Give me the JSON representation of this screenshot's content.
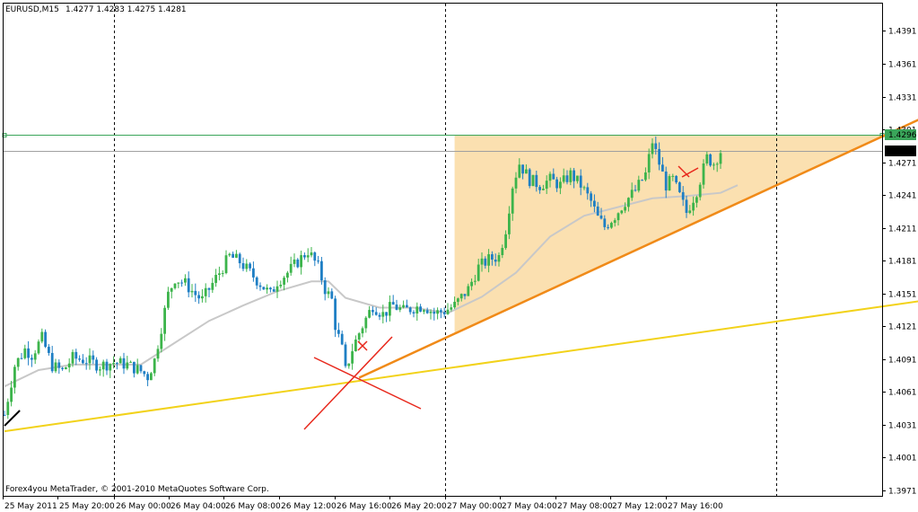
{
  "header": {
    "symbol_tf": "EURUSD,M15",
    "ohlc": "1.4277 1.4283 1.4275 1.4281"
  },
  "footer": {
    "copyright": "Forex4you MetaTrader, © 2001-2010 MetaQuotes Software Corp."
  },
  "colors": {
    "background": "#ffffff",
    "frame": "#000000",
    "bull_candle": "#3cb44b",
    "bear_candle": "#1f7fc4",
    "moving_average": "#c8c8c8",
    "zone_fill": "#fbe0b0",
    "resistance_line": "#3aa55a",
    "price_line": "#a0a0a0",
    "rising_trendline": "#f08a18",
    "support_trendline": "#f2d21a",
    "cross_marks": "#e8281c"
  },
  "chart_data": {
    "type": "candlestick",
    "symbol": "EURUSD",
    "timeframe": "M15",
    "ylim": [
      1.3966,
      1.4416
    ],
    "y_ticks": [
      "1.4391",
      "1.4361",
      "1.4331",
      "1.4301",
      "1.4271",
      "1.4241",
      "1.4211",
      "1.4181",
      "1.4151",
      "1.4121",
      "1.4091",
      "1.4061",
      "1.4031",
      "1.4001",
      "1.3971"
    ],
    "x_ticks": [
      "25 May 2011",
      "25 May 20:00",
      "26 May 00:00",
      "26 May 04:00",
      "26 May 08:00",
      "26 May 12:00",
      "26 May 16:00",
      "26 May 20:00",
      "27 May 00:00",
      "27 May 04:00",
      "27 May 08:00",
      "27 May 12:00",
      "27 May 16:00"
    ],
    "period_separators": [
      "25 May 20:00",
      "26 May 00:00",
      "26 May 20:00",
      "27 May 00:00",
      "27 May 16:00"
    ],
    "price_labels": {
      "resistance": "1.4296",
      "current": "1.4281"
    },
    "horizontal_lines": [
      {
        "role": "resistance",
        "price": 1.4296
      },
      {
        "role": "current-price",
        "price": 1.4281
      }
    ],
    "close_path": [
      [
        0,
        1.404
      ],
      [
        3,
        1.4085
      ],
      [
        6,
        1.41
      ],
      [
        8,
        1.4095
      ],
      [
        11,
        1.411
      ],
      [
        14,
        1.4085
      ],
      [
        17,
        1.408
      ],
      [
        20,
        1.4092
      ],
      [
        24,
        1.409
      ],
      [
        28,
        1.4085
      ],
      [
        32,
        1.4088
      ],
      [
        36,
        1.4086
      ],
      [
        40,
        1.408
      ],
      [
        42,
        1.4075
      ],
      [
        44,
        1.409
      ],
      [
        46,
        1.412
      ],
      [
        48,
        1.415
      ],
      [
        50,
        1.4165
      ],
      [
        53,
        1.416
      ],
      [
        56,
        1.415
      ],
      [
        58,
        1.4145
      ],
      [
        60,
        1.4155
      ],
      [
        63,
        1.417
      ],
      [
        66,
        1.4185
      ],
      [
        69,
        1.418
      ],
      [
        72,
        1.417
      ],
      [
        75,
        1.416
      ],
      [
        78,
        1.415
      ],
      [
        80,
        1.4162
      ],
      [
        83,
        1.417
      ],
      [
        86,
        1.418
      ],
      [
        89,
        1.419
      ],
      [
        92,
        1.4175
      ],
      [
        94,
        1.4155
      ],
      [
        96,
        1.4145
      ],
      [
        97,
        1.4122
      ],
      [
        99,
        1.41
      ],
      [
        100,
        1.408
      ],
      [
        101,
        1.409
      ],
      [
        102,
        1.41
      ],
      [
        104,
        1.4115
      ],
      [
        106,
        1.4128
      ],
      [
        108,
        1.414
      ],
      [
        111,
        1.4132
      ],
      [
        114,
        1.414
      ],
      [
        117,
        1.4135
      ],
      [
        120,
        1.4138
      ],
      [
        123,
        1.414
      ],
      [
        126,
        1.4133
      ],
      [
        129,
        1.4135
      ],
      [
        132,
        1.414
      ],
      [
        136,
        1.4155
      ],
      [
        139,
        1.4175
      ],
      [
        142,
        1.4182
      ],
      [
        145,
        1.4185
      ],
      [
        147,
        1.421
      ],
      [
        149,
        1.425
      ],
      [
        151,
        1.427
      ],
      [
        154,
        1.4255
      ],
      [
        157,
        1.425
      ],
      [
        160,
        1.4255
      ],
      [
        163,
        1.425
      ],
      [
        166,
        1.426
      ],
      [
        169,
        1.425
      ],
      [
        172,
        1.4235
      ],
      [
        174,
        1.422
      ],
      [
        176,
        1.4212
      ],
      [
        179,
        1.4222
      ],
      [
        182,
        1.4235
      ],
      [
        185,
        1.4245
      ],
      [
        188,
        1.426
      ],
      [
        190,
        1.429
      ],
      [
        192,
        1.427
      ],
      [
        194,
        1.425
      ],
      [
        196,
        1.4255
      ],
      [
        198,
        1.424
      ],
      [
        200,
        1.4225
      ],
      [
        203,
        1.4245
      ],
      [
        206,
        1.4275
      ],
      [
        208,
        1.427
      ],
      [
        210,
        1.4281
      ]
    ],
    "moving_average_path": [
      [
        0,
        1.4066
      ],
      [
        10,
        1.4081
      ],
      [
        20,
        1.4086
      ],
      [
        30,
        1.4086
      ],
      [
        40,
        1.4086
      ],
      [
        50,
        1.4106
      ],
      [
        60,
        1.4126
      ],
      [
        70,
        1.414
      ],
      [
        80,
        1.4153
      ],
      [
        90,
        1.4162
      ],
      [
        95,
        1.4162
      ],
      [
        100,
        1.4147
      ],
      [
        110,
        1.4138
      ],
      [
        120,
        1.4138
      ],
      [
        130,
        1.4133
      ],
      [
        140,
        1.4148
      ],
      [
        150,
        1.417
      ],
      [
        160,
        1.4203
      ],
      [
        170,
        1.4222
      ],
      [
        180,
        1.423
      ],
      [
        190,
        1.4238
      ],
      [
        200,
        1.424
      ],
      [
        210,
        1.4243
      ],
      [
        215,
        1.425
      ]
    ],
    "trendlines": [
      {
        "role": "support",
        "from": [
          0,
          1.4025
        ],
        "to": [
          300,
          1.4158
        ]
      },
      {
        "role": "rising",
        "from": [
          104,
          1.4074
        ],
        "to": [
          280,
          1.4327
        ]
      }
    ],
    "shaded_zone": {
      "from_bar": 132,
      "to_bar": 261,
      "top": 1.4296,
      "bottom_follows": "rising"
    }
  }
}
